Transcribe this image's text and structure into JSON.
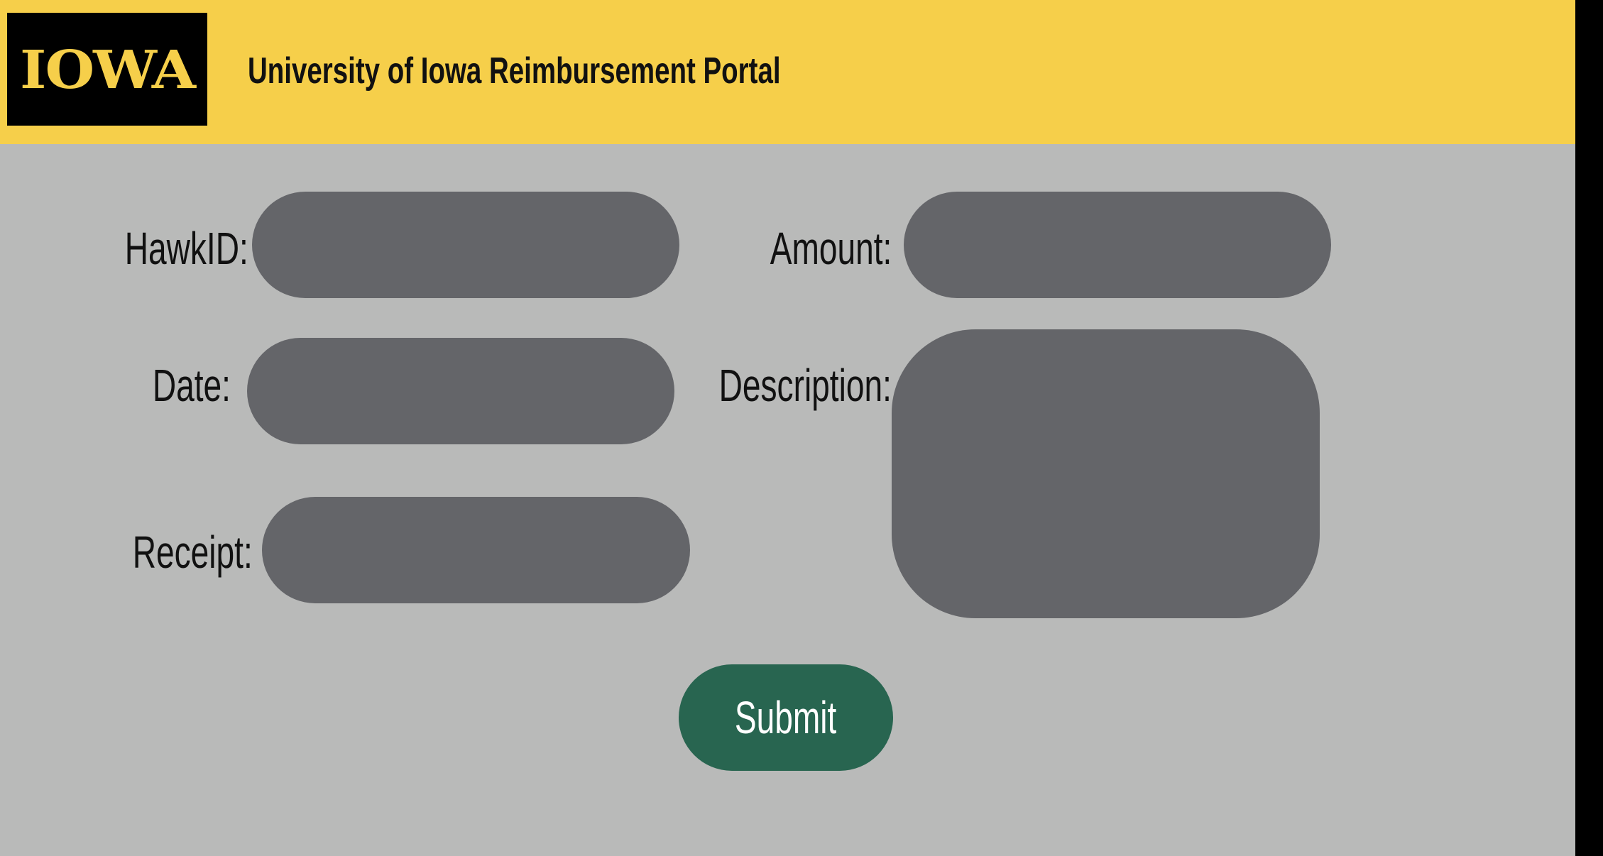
{
  "header": {
    "logo_text": "IOWA",
    "title": "University of Iowa Reimbursement Portal"
  },
  "form": {
    "hawkid_label": "HawkID:",
    "hawkid_value": "",
    "date_label": "Date:",
    "date_value": "",
    "receipt_label": "Receipt:",
    "receipt_value": "",
    "amount_label": "Amount:",
    "amount_value": "",
    "description_label": "Description:",
    "description_value": "",
    "submit_label": "Submit"
  },
  "colors": {
    "brand_gold": "#f6cf4a",
    "brand_black": "#000000",
    "background": "#b9bab9",
    "field": "#646569",
    "submit": "#286550"
  },
  "icons": {
    "logo": "iowa-wordmark-logo"
  }
}
